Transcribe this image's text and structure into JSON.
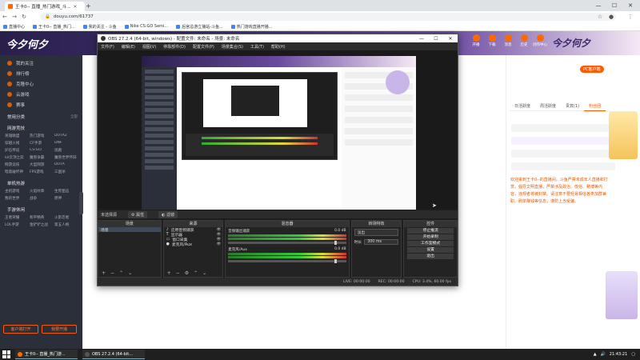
{
  "browser": {
    "tabs": [
      {
        "title": "王卡0-- 直播_热门游戏_斗..."
      },
      {
        "title": "王卡0-- 直播_热门..."
      }
    ],
    "url": "douyu.com/61737",
    "bookmarks": [
      "直播中心",
      "王卡0-- 直播_热门...",
      "我的关注 - 斗鱼",
      "Nike CS:GO Semi...",
      "后宫总游立播站-斗鱼...",
      "热门游戏直播开播..."
    ]
  },
  "site": {
    "logo": "今夕何夕",
    "logo_right": "今夕何夕",
    "top_actions": [
      "开播",
      "下载",
      "消息",
      "历史",
      "创作中心"
    ]
  },
  "sidebar": {
    "items": [
      "我的关注",
      "排行榜",
      "克隆中心",
      "云游戏",
      "赛事"
    ],
    "sections": [
      {
        "title": "常用分类",
        "more": "全部",
        "entries": []
      },
      {
        "title": "网游竞技",
        "more": "",
        "entries": [
          "英雄联盟",
          "热门游戏",
          "DOTA2",
          "穿越火线",
          "CF手游",
          "DNF",
          "炉石传说",
          "CS:GO",
          "逃跑",
          "lol云顶之弈",
          "魔兽争霸",
          "魔兽世界怀旧",
          "网游竞技",
          "大型网游",
          "DOTA",
          "暗黑破坏神",
          "FPS游戏",
          "三国杀"
        ]
      },
      {
        "title": "单机热游",
        "more": "",
        "entries": [
          "主机游戏",
          "火焰纹章",
          "生死狙击",
          "我的世界",
          "战争",
          "原神"
        ]
      },
      {
        "title": "手游休闲",
        "more": "",
        "entries": [
          "王者荣耀",
          "和平精英",
          "火影忍者",
          "LOL手游",
          "金铲铲之战",
          "第五人格"
        ]
      }
    ],
    "btn_open": "客户端打开",
    "btn_stream": "我要开播"
  },
  "right_panel": {
    "pill": "PC客户端",
    "tabs": [
      "日活跃度",
      "周活跃度",
      "贵宾(1)",
      "粉丝团"
    ],
    "chat_note": "欢迎来到王卡0--的直播间。斗鱼严禁未成年人直播和打赏。倡导文明直播，严禁涉及政治、低俗、赌博等内容，违规者将被封禁。请注意不要轻易相信各类加群兼职、刷单赚钱等信息，谨防上当受骗。"
  },
  "obs": {
    "title": "OBS 27.2.4 (64-bit, windows) - 配置文件: 未命名 - 场景: 未命名",
    "menu": [
      "文件(F)",
      "编辑(E)",
      "视图(V)",
      "停靠部件(D)",
      "配置文件(P)",
      "场景集合(S)",
      "工具(T)",
      "帮助(H)"
    ],
    "bar": {
      "label": "未选择源",
      "props": "属性",
      "filters": "滤镜"
    },
    "docks": {
      "scenes": {
        "title": "场景",
        "items": [
          "场景"
        ]
      },
      "sources": {
        "title": "来源",
        "items": [
          "应用音频捕获",
          "显示器",
          "窗口采集",
          "麦克风/Aux"
        ]
      },
      "mixer": {
        "title": "混音器",
        "channels": [
          {
            "name": "音频输出捕获",
            "db": "0.0 dB"
          },
          {
            "name": "麦克风/Aux",
            "db": "0.0 dB"
          }
        ]
      },
      "transitions": {
        "title": "转场特效",
        "type": "淡出",
        "duration_label": "时长",
        "duration": "300 ms"
      },
      "controls": {
        "title": "控件",
        "buttons": [
          "停止推流",
          "开始录制",
          "工作室模式",
          "设置",
          "退出"
        ]
      }
    },
    "status": {
      "live": "LIVE: 00:00:00",
      "rec": "REC: 00:00:00",
      "cpu": "CPU: 3.4%, 60.00 fps"
    }
  },
  "taskbar": {
    "tasks": [
      "王卡0-- 直播_热门游...",
      "OBS 27.2.4 (64-bit..."
    ],
    "time": "21:43:21"
  }
}
